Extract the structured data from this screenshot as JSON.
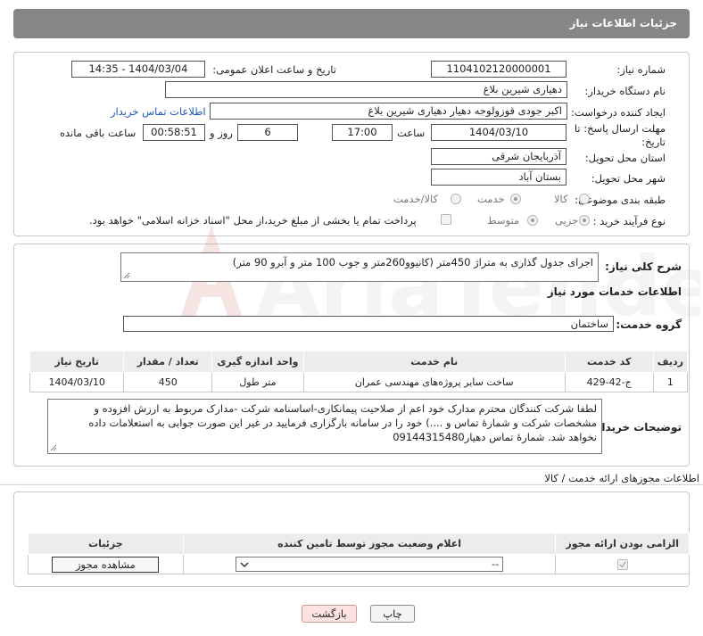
{
  "header": {
    "title": "جزئیات اطلاعات نیاز"
  },
  "form": {
    "need_number": {
      "label": "شماره نیاز:",
      "value": "1104102120000001"
    },
    "announce_datetime": {
      "label": "تاریخ و ساعت اعلان عمومی:",
      "value": "1404/03/04 - 14:35"
    },
    "buyer_org": {
      "label": "نام دستگاه خریدار:",
      "value": "دهیاری شیرین بلاغ"
    },
    "requester": {
      "label": "ایجاد کننده درخواست:",
      "value": "اکبر جودی قوزولوجه دهیار دهیاری شیرین بلاغ",
      "contact_link": "اطلاعات تماس خریدار"
    },
    "deadline": {
      "label_line1": "مهلت ارسال پاسخ: تا",
      "label_line2": "تاریخ:",
      "date": "1404/03/10",
      "time_label": "ساعت",
      "time": "17:00",
      "days": "6",
      "day_label": "روز و",
      "remaining": "00:58:51",
      "remaining_label": "ساعت باقی مانده"
    },
    "province": {
      "label": "استان محل تحویل:",
      "value": "آذربایجان شرقی"
    },
    "city": {
      "label": "شهر محل تحویل:",
      "value": "بستان آباد"
    },
    "category": {
      "label": "طبقه بندی موضوعی:",
      "options": [
        "کالا",
        "خدمت",
        "کالا/خدمت"
      ],
      "selected": "خدمت"
    },
    "process": {
      "label": "نوع فرآیند خرید :",
      "options": [
        "جزیی",
        "متوسط"
      ],
      "selected": "جزیی",
      "payment_note": "پرداخت تمام یا بخشی از مبلغ خرید،از محل \"اسناد خزانه اسلامی\" خواهد بود."
    }
  },
  "summary": {
    "label": "شرح کلی نیاز:",
    "value": "اجرای جدول گذاری به متراژ 450متر (کانیوو260متر و جوب 100 متر و آبرو 90 متر)"
  },
  "services": {
    "section_title": "اطلاعات خدمات مورد نیاز",
    "group_label": "گروه خدمت:",
    "group_value": "ساختمان",
    "columns": [
      "ردیف",
      "کد خدمت",
      "نام خدمت",
      "واحد اندازه گیری",
      "تعداد / مقدار",
      "تاریخ نیاز"
    ],
    "rows": [
      {
        "row": "1",
        "code": "ج-42-429",
        "name": "ساخت سایر پروژه‌های مهندسی عمران",
        "unit": "متر طول",
        "qty": "450",
        "date": "1404/03/10"
      }
    ]
  },
  "buyer_notes": {
    "label": "توضیحات خریدار:",
    "line1": "لطفا شرکت کنندگان محترم مدارک خود اعم از صلاحیت پیمانکاری-اساسنامه شرکت -مدارک مربوط به ارزش افزوده و",
    "line2": "مشخصات شرکت و شمارهٔ تماس و ....) خود را در سامانه بارگزاری فرمایید در غیر این صورت جوابی به استعلامات داده",
    "line3": "نخواهد شد. شمارهٔ تماس دهیار09144315480"
  },
  "permits": {
    "section_title": "اطلاعات مجوزهای ارائه خدمت / کالا",
    "columns": [
      "الزامی بودن ارائه مجوز",
      "اعلام وضعیت مجوز توسط تامین کننده",
      "جزئیات"
    ],
    "select_value": "--",
    "view_button": "مشاهده مجوز"
  },
  "footer": {
    "print": "چاپ",
    "back": "بازگشت"
  },
  "watermark": {
    "text": "AriaTender.neT"
  },
  "colors": {
    "header_bg": "#868686",
    "link": "#1a55c0",
    "back_button_bg": "#fde2e2"
  }
}
